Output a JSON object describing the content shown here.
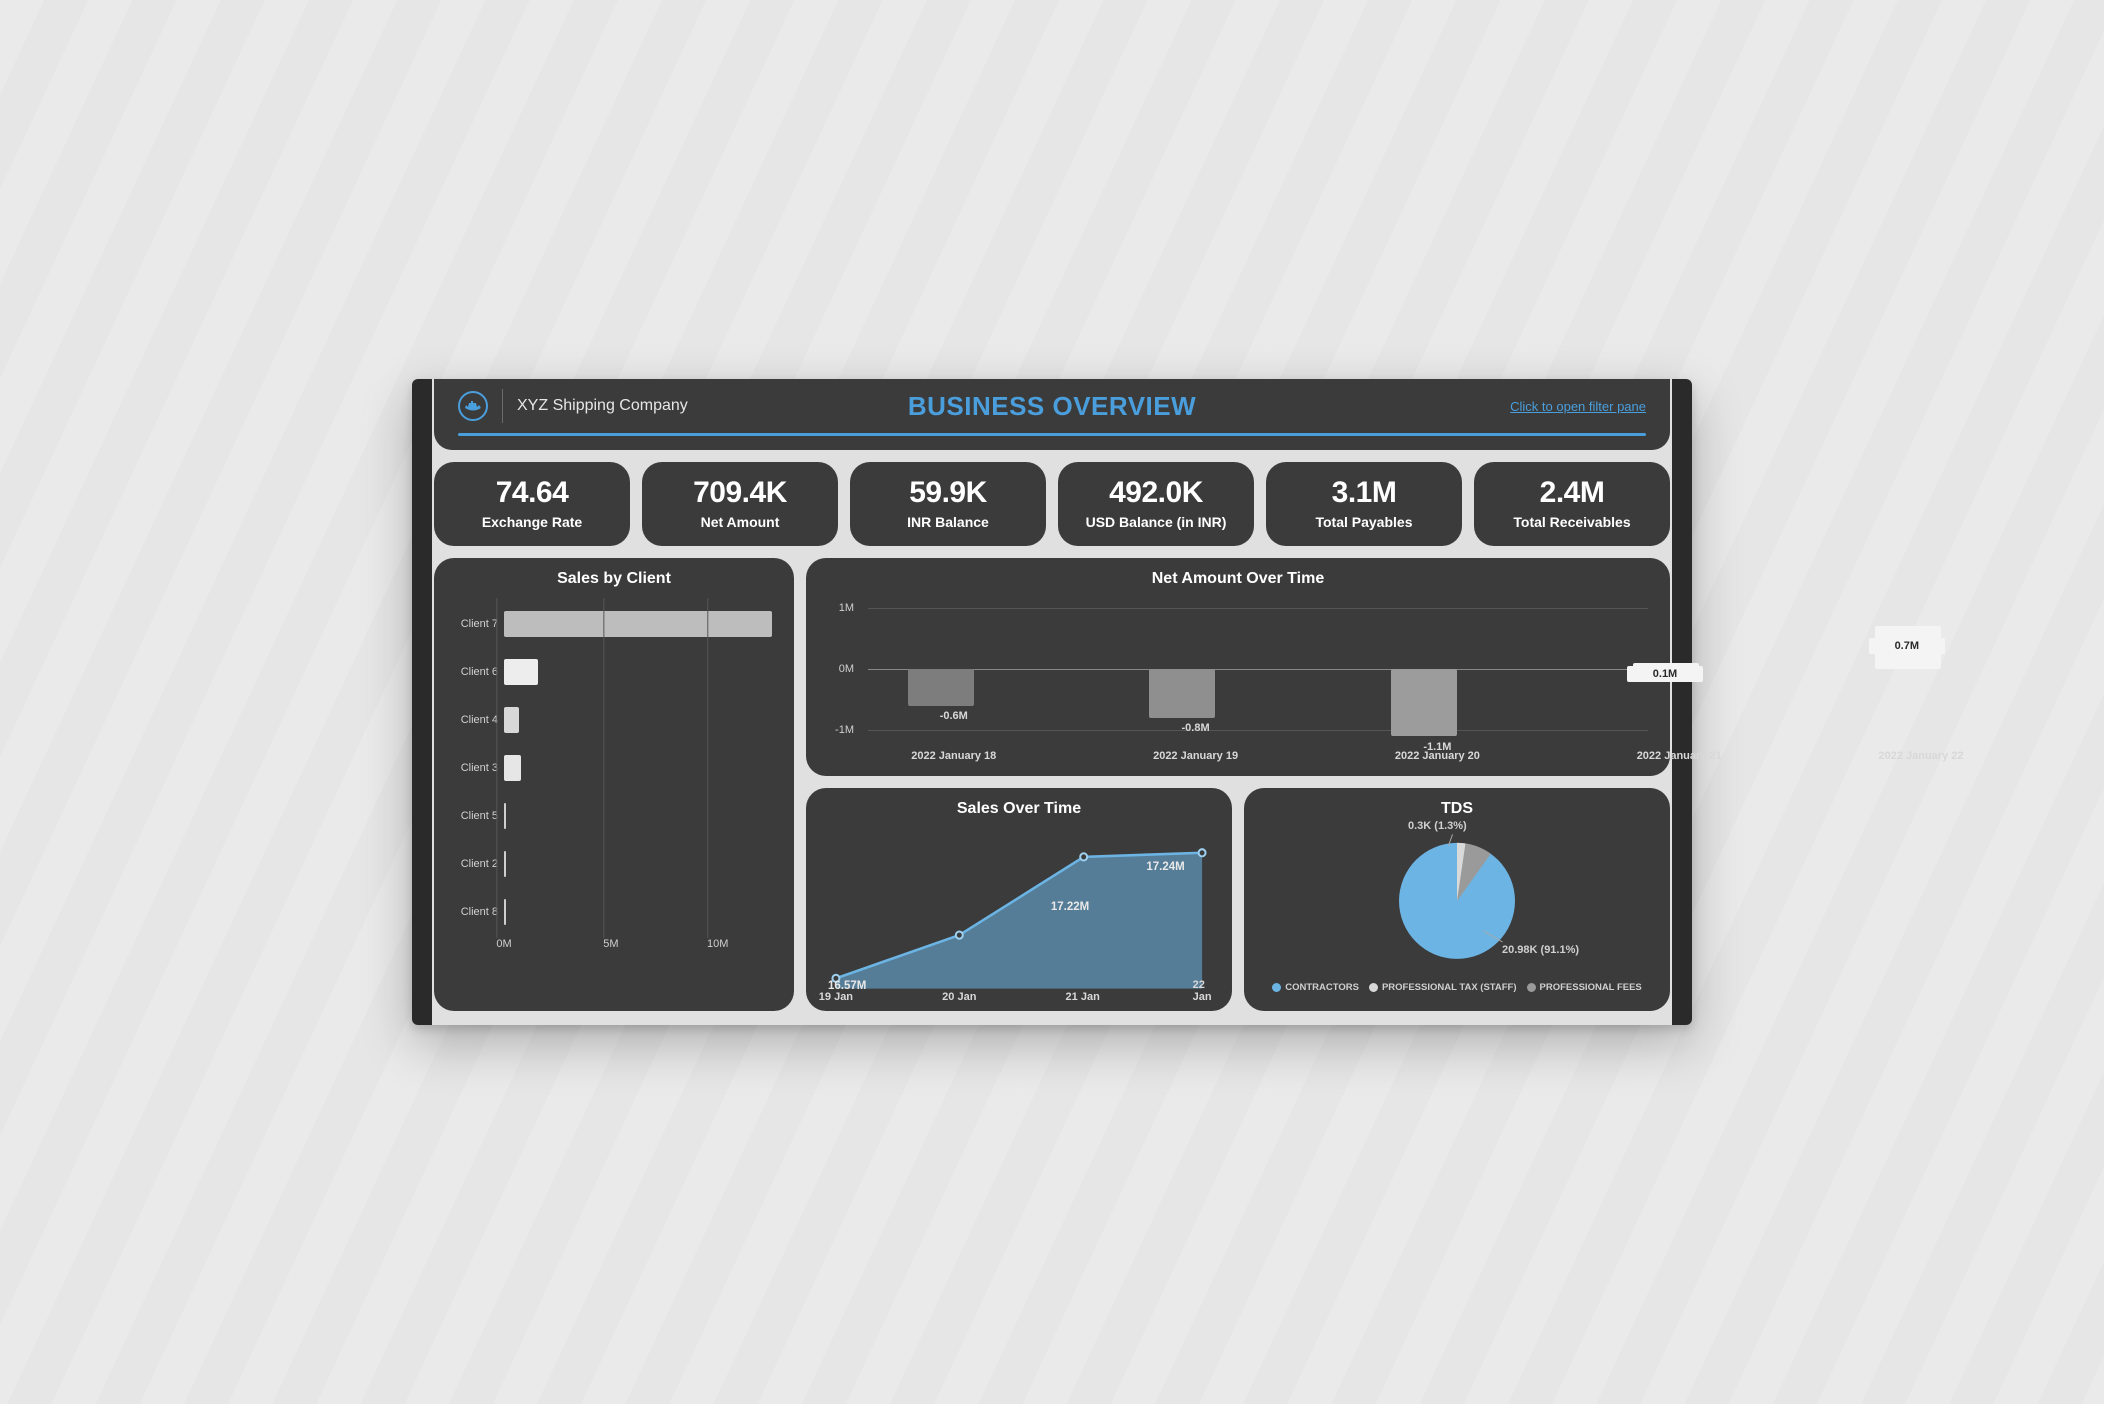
{
  "header": {
    "company": "XYZ Shipping Company",
    "title": "BUSINESS OVERVIEW",
    "filter_link": "Click to open filter pane"
  },
  "kpis": [
    {
      "value": "74.64",
      "label": "Exchange Rate"
    },
    {
      "value": "709.4K",
      "label": "Net Amount"
    },
    {
      "value": "59.9K",
      "label": "INR Balance"
    },
    {
      "value": "492.0K",
      "label": "USD Balance (in INR)"
    },
    {
      "value": "3.1M",
      "label": "Total Payables"
    },
    {
      "value": "2.4M",
      "label": "Total Receivables"
    }
  ],
  "sales_by_client": {
    "title": "Sales by Client",
    "axis": [
      "0M",
      "5M",
      "10M"
    ]
  },
  "net_amount": {
    "title": "Net Amount Over Time",
    "yticks": [
      "1M",
      "0M",
      "-1M"
    ]
  },
  "sales_over_time": {
    "title": "Sales Over Time"
  },
  "tds": {
    "title": "TDS",
    "label_top": "0.3K (1.3%)",
    "label_bottom": "20.98K (91.1%)",
    "legend": [
      "CONTRACTORS",
      "PROFESSIONAL TAX  (STAFF)",
      "PROFESSIONAL FEES"
    ]
  },
  "chart_data": [
    {
      "type": "bar",
      "title": "Sales by Client",
      "orientation": "horizontal",
      "categories": [
        "Client 7",
        "Client 6",
        "Client 4",
        "Client 3",
        "Client 5",
        "Client 2",
        "Client 8"
      ],
      "values": [
        12.7,
        1.6,
        0.7,
        0.8,
        0.1,
        0.1,
        0.1
      ],
      "xlabel": "",
      "ylabel": "",
      "xlim": [
        0,
        13
      ]
    },
    {
      "type": "bar",
      "title": "Net Amount Over Time",
      "categories": [
        "2022 January 18",
        "2022 January 19",
        "2022 January 20",
        "2022 January 21",
        "2022 January 22"
      ],
      "values": [
        -0.6,
        -0.8,
        -1.1,
        0.1,
        0.7
      ],
      "value_labels": [
        "-0.6M",
        "-0.8M",
        "-1.1M",
        "0.1M",
        "0.7M"
      ],
      "ylim": [
        -1.2,
        1.0
      ]
    },
    {
      "type": "area",
      "title": "Sales Over Time",
      "x": [
        "19 Jan",
        "20 Jan",
        "21 Jan",
        "22 Jan"
      ],
      "values": [
        16.57,
        16.9,
        17.22,
        17.24
      ],
      "value_labels": [
        "16.57M",
        "",
        "17.22M",
        "17.24M"
      ],
      "ylim": [
        16.5,
        17.3
      ]
    },
    {
      "type": "pie",
      "title": "TDS",
      "series": [
        {
          "name": "CONTRACTORS",
          "value": 20.98,
          "pct": 91.1,
          "color": "#6cb4e4"
        },
        {
          "name": "PROFESSIONAL TAX (STAFF)",
          "value": 0.3,
          "pct": 1.3,
          "color": "#d9d9d9"
        },
        {
          "name": "PROFESSIONAL FEES",
          "value": 1.75,
          "pct": 7.6,
          "color": "#9a9a9a"
        }
      ]
    }
  ]
}
